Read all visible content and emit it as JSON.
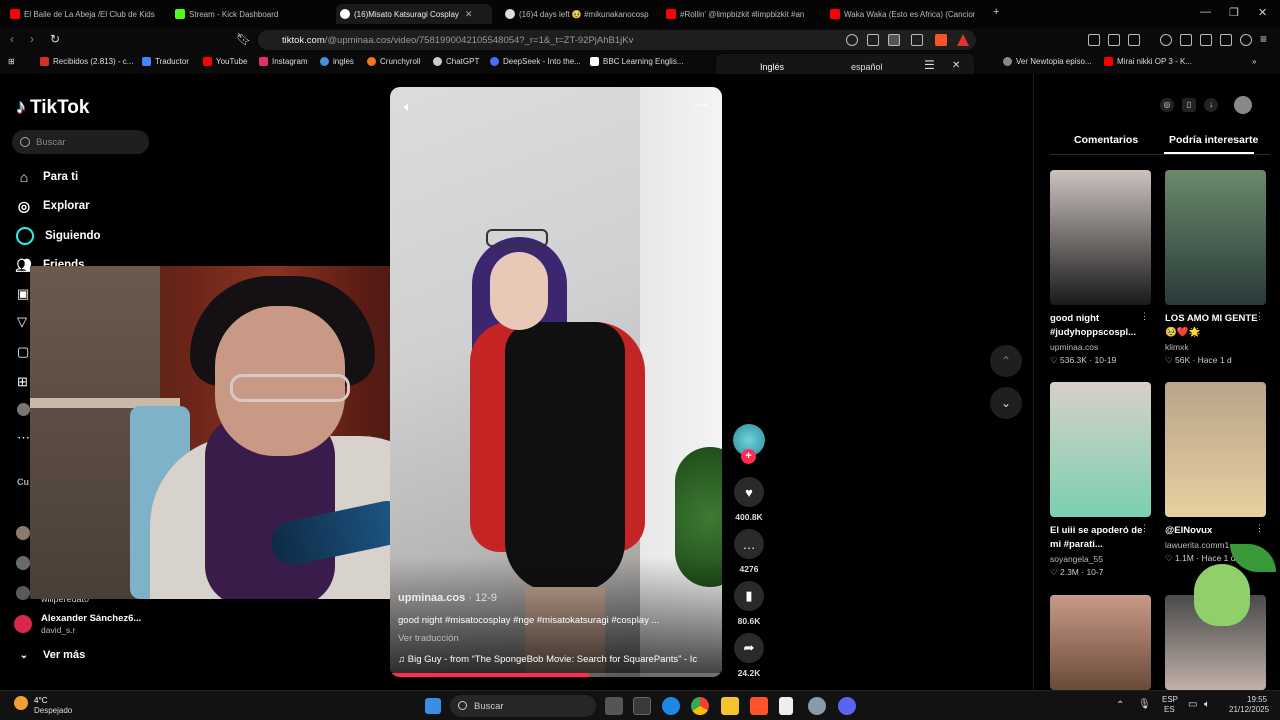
{
  "tabs": [
    {
      "title": "El Baile de La Abeja /El Club de Kids",
      "color": "#ff0000"
    },
    {
      "title": "Stream - Kick Dashboard",
      "color": "#53fc18"
    },
    {
      "title": "(16)Misato Katsuragi Cosplay",
      "color": "#ffffff"
    },
    {
      "title": "(16)4 days left 🥹 #mikunakanocosp",
      "color": "#ffffff"
    },
    {
      "title": "#Rollin' @limpbizkit #limpbizkit #an",
      "color": "#ff0000"
    },
    {
      "title": "Waka Waka (Esto es Africa) (Cancion",
      "color": "#ff0000"
    }
  ],
  "address": {
    "domain": "tiktok.com",
    "path": "/@upminaa.cos/video/7581990042105548054?_r=1&_t=ZT-92PjAhB1jKv"
  },
  "bookmarks": [
    {
      "label": "Recibidos (2.813) - c...",
      "color": "#d93025"
    },
    {
      "label": "Traductor",
      "color": "#4285f4"
    },
    {
      "label": "YouTube",
      "color": "#ff0000"
    },
    {
      "label": "Instagram",
      "color": "#e1306c"
    },
    {
      "label": "ingles",
      "color": "#4a90d9"
    },
    {
      "label": "Crunchyroll",
      "color": "#f47521"
    },
    {
      "label": "ChatGPT",
      "color": "#cccccc"
    },
    {
      "label": "DeepSeek - Into the...",
      "color": "#4d6bfe"
    },
    {
      "label": "BBC Learning Englis...",
      "color": "#ffffff"
    },
    {
      "label": "Ver Newtopia episo...",
      "color": "#888888"
    },
    {
      "label": "Mirai nikki OP 3 - K...",
      "color": "#ff0000"
    }
  ],
  "translate": {
    "from": "Inglés",
    "to": "español"
  },
  "brand": "TikTok",
  "search_placeholder": "Buscar",
  "nav": [
    {
      "label": "Para ti",
      "icon": "home-icon"
    },
    {
      "label": "Explorar",
      "icon": "compass-icon"
    },
    {
      "label": "Siguiendo",
      "icon": "following-icon"
    },
    {
      "label": "Friends",
      "icon": "friends-icon"
    }
  ],
  "following_section_label": "Cu",
  "accounts": [
    {
      "name": "willperedat0",
      "user": ""
    },
    {
      "name": "Alexander Sánchez6...",
      "user": "david_s.r"
    }
  ],
  "see_more": "Ver más",
  "video": {
    "author": "upminaa.cos",
    "date": "12-9",
    "description": "good night #misatocosplay #nge #misatokatsuragi #cosplay ...",
    "translate_link": "Ver traducción",
    "music": "Big Guy - from “The SpongeBob Movie: Search for SquarePants” - Ic",
    "progress": 0.6,
    "likes": "400.8K",
    "comments": "4276",
    "saves": "80.6K",
    "shares": "24.2K"
  },
  "panel": {
    "tabs": [
      "Comentarios",
      "Podría interesarte"
    ],
    "active_tab": 1,
    "cards": [
      {
        "title": "good night #judyhoppscospl...",
        "user": "upminaa.cos",
        "likes": "536.3K",
        "date": "10-19",
        "colors": [
          "#ccc3c0",
          "#1a1a1a"
        ]
      },
      {
        "title": "LOS AMO MI GENTE 🥹❤️🌟",
        "user": "klimxk",
        "likes": "56K",
        "date": "Hace 1 d",
        "colors": [
          "#6a8a6a",
          "#2a3a3a"
        ]
      },
      {
        "title": "El uiii se apoderó de mi #parati...",
        "user": "soyangela_55",
        "likes": "2.3M",
        "date": "10-7",
        "colors": [
          "#d8d0c8",
          "#7ad0b0"
        ]
      },
      {
        "title": "@ElNovux",
        "user": "lawuerita.comm1",
        "likes": "1.1M",
        "date": "Hace 1 d",
        "colors": [
          "#b8a48a",
          "#e8d0a0"
        ]
      },
      {
        "title": "",
        "user": "",
        "likes": "",
        "date": "",
        "colors": [
          "#c89a88",
          "#6a4a3a"
        ]
      },
      {
        "title": "",
        "user": "",
        "likes": "",
        "date": "",
        "colors": [
          "#4a4a4a",
          "#c0b0a8"
        ]
      }
    ]
  },
  "weather": {
    "temp": "4°C",
    "label": "Despejado"
  },
  "taskbar_search": "Buscar",
  "tray": {
    "lang1": "ESP",
    "lang2": "ES",
    "time": "19:55",
    "date": "21/12/2025"
  }
}
